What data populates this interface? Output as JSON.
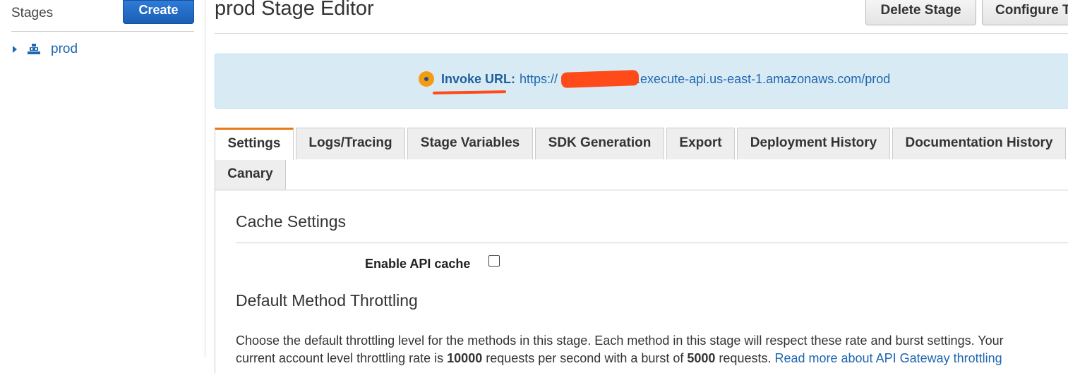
{
  "sidebar": {
    "title": "Stages",
    "create_label": "Create",
    "tree": [
      {
        "label": "prod"
      }
    ]
  },
  "header": {
    "title": "prod Stage Editor",
    "delete_label": "Delete Stage",
    "configure_label": "Configure T"
  },
  "invoke": {
    "label": "Invoke URL:",
    "url_prefix": "https://",
    "url_suffix": ".execute-api.us-east-1.amazonaws.com/prod"
  },
  "tabs": [
    {
      "label": "Settings",
      "active": true
    },
    {
      "label": "Logs/Tracing"
    },
    {
      "label": "Stage Variables"
    },
    {
      "label": "SDK Generation"
    },
    {
      "label": "Export"
    },
    {
      "label": "Deployment History"
    },
    {
      "label": "Documentation History"
    },
    {
      "label": "Canary"
    }
  ],
  "cache": {
    "title": "Cache Settings",
    "enable_label": "Enable API cache",
    "enabled": false
  },
  "throttling": {
    "title": "Default Method Throttling",
    "desc_line1": "Choose the default throttling level for the methods in this stage. Each method in this stage will respect these rate and burst settings. Your",
    "desc_line2_a": "current account level throttling rate is ",
    "rate": "10000",
    "desc_line2_b": " requests per second with a burst of ",
    "burst": "5000",
    "desc_line2_c": " requests. ",
    "link": "Read more about API Gateway throttling"
  },
  "colors": {
    "accent_orange": "#e97a18",
    "link_blue": "#1f66b0",
    "panel_blue": "#d8ebf5",
    "annotation_red": "#ff4a1a"
  },
  "icons": {
    "tree_caret": "caret-right-icon",
    "stage": "stage-icon",
    "invoke_status": "status-dot-icon"
  }
}
